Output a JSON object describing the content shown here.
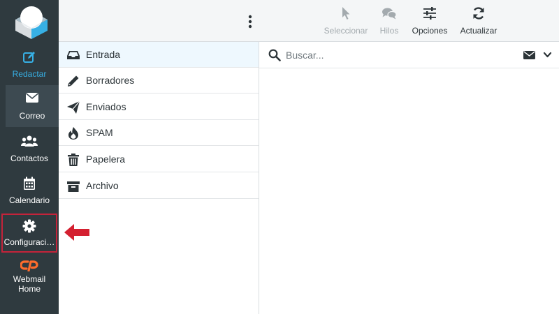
{
  "nav": {
    "compose": {
      "label": "Redactar",
      "icon": "compose-icon"
    },
    "mail": {
      "label": "Correo",
      "icon": "envelope-icon"
    },
    "contacts": {
      "label": "Contactos",
      "icon": "users-icon"
    },
    "calendar": {
      "label": "Calendario",
      "icon": "calendar-icon"
    },
    "settings": {
      "label": "Configuraci…",
      "icon": "gear-icon"
    },
    "cpanel": {
      "line1": "Webmail",
      "line2": "Home",
      "icon": "cpanel-icon"
    }
  },
  "folders": [
    {
      "label": "Entrada",
      "icon": "inbox-icon",
      "selected": true
    },
    {
      "label": "Borradores",
      "icon": "pencil-icon"
    },
    {
      "label": "Enviados",
      "icon": "paper-plane-icon"
    },
    {
      "label": "SPAM",
      "icon": "fire-icon"
    },
    {
      "label": "Papelera",
      "icon": "trash-icon"
    },
    {
      "label": "Archivo",
      "icon": "archive-icon"
    }
  ],
  "toolbar": {
    "select_label": "Seleccionar",
    "threads_label": "Hilos",
    "options_label": "Opciones",
    "refresh_label": "Actualizar"
  },
  "search": {
    "placeholder": "Buscar..."
  },
  "colors": {
    "nav_bg": "#2f3a3f",
    "nav_active": "#3d4a51",
    "accent": "#37b0e5",
    "highlight_border": "#c4233a",
    "annotation_arrow": "#d42030",
    "cpanel_orange": "#ff6c2c",
    "selected_folder_bg": "#eef8fe"
  }
}
